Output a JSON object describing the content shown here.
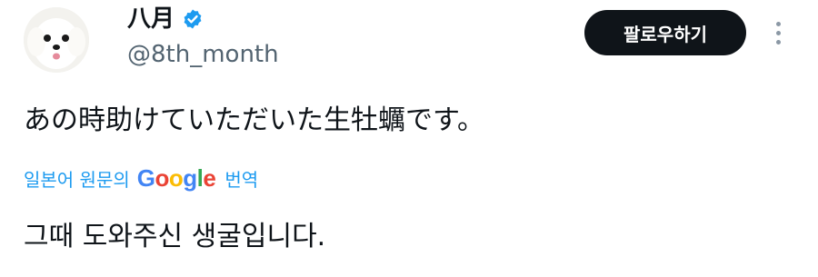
{
  "user": {
    "display_name": "八月",
    "handle": "@8th_month",
    "verified_icon": "verified-badge-icon",
    "avatar_icon": "white-dog-avatar"
  },
  "actions": {
    "follow_label": "팔로우하기",
    "more_icon": "more-options-icon"
  },
  "tweet": {
    "text": "あの時助けていただいた生牡蠣です。"
  },
  "translation": {
    "label": "일본어 원문의",
    "provider_letters": [
      "G",
      "o",
      "o",
      "g",
      "l",
      "e"
    ],
    "action": "번역",
    "translated_text": "그때 도와주신 생굴입니다."
  },
  "colors": {
    "accent": "#1d9bf0",
    "button_bg": "#0f1419",
    "handle": "#536471"
  }
}
